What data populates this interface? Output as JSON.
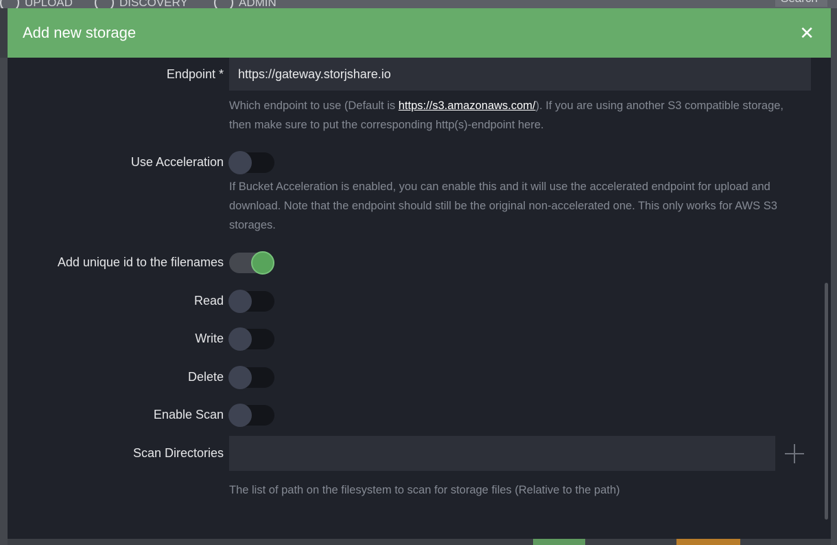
{
  "background": {
    "nav": [
      "UPLOAD",
      "DISCOVERY",
      "ADMIN"
    ],
    "search_label": "Search"
  },
  "modal": {
    "title": "Add new storage",
    "close_icon": "close-icon"
  },
  "fields": {
    "endpoint": {
      "label": "Endpoint *",
      "value": "https://gateway.storjshare.io",
      "help_pre": "Which endpoint to use (Default is ",
      "help_link": "https://s3.amazonaws.com/",
      "help_post": "). If you are using another S3 compatible storage, then make sure to put the corresponding http(s)-endpoint here."
    },
    "use_acceleration": {
      "label": "Use Acceleration",
      "on": false,
      "help": "If Bucket Acceleration is enabled, you can enable this and it will use the accelerated endpoint for upload and download. Note that the endpoint should still be the original non-accelerated one. This only works for AWS S3 storages."
    },
    "unique_id": {
      "label": "Add unique id to the filenames",
      "on": true
    },
    "read": {
      "label": "Read",
      "on": false
    },
    "write": {
      "label": "Write",
      "on": false
    },
    "delete": {
      "label": "Delete",
      "on": false
    },
    "enable_scan": {
      "label": "Enable Scan",
      "on": false
    },
    "scan_directories": {
      "label": "Scan Directories",
      "value": "",
      "add_icon": "plus-icon",
      "help": "The list of path on the filesystem to scan for storage files (Relative to the path)"
    }
  },
  "colors": {
    "header": "#67ac6a",
    "modal_bg": "#1f222a",
    "toggle_on": "#58a45b",
    "input_bg": "#2d3039"
  }
}
